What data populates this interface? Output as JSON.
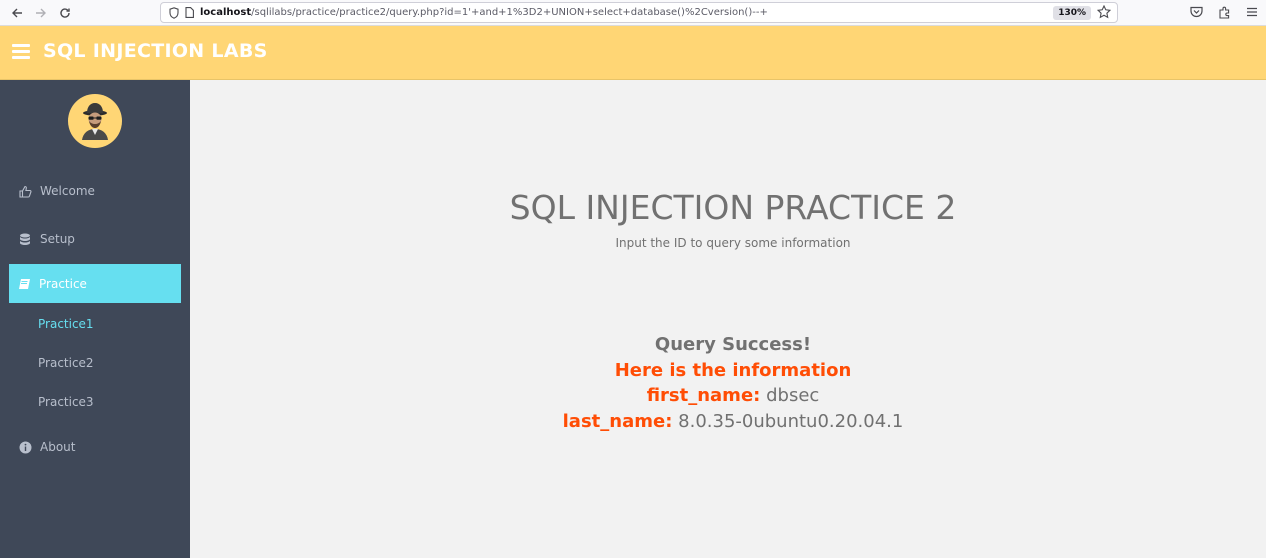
{
  "browser": {
    "url_host": "localhost",
    "url_path": "/sqlilabs/practice/practice2/query.php?id=1'+and+1%3D2+UNION+select+database()%2Cversion()--+",
    "zoom": "130%"
  },
  "header": {
    "title": "SQL INJECTION LABS",
    "bg_color": "#ffd675"
  },
  "sidebar": {
    "bg_color": "#3f4858",
    "accent_color": "#66dff0",
    "items": [
      {
        "label": "Welcome",
        "icon": "thumbs-up-icon"
      },
      {
        "label": "Setup",
        "icon": "database-icon"
      },
      {
        "label": "Practice",
        "icon": "book-icon",
        "active": true
      },
      {
        "label": "About",
        "icon": "info-icon"
      }
    ],
    "sub_items": [
      {
        "label": "Practice1",
        "current": true
      },
      {
        "label": "Practice2"
      },
      {
        "label": "Practice3"
      }
    ]
  },
  "main": {
    "title": "SQL INJECTION PRACTICE 2",
    "subtitle": "Input the ID to query some information",
    "result": {
      "status": "Query Success!",
      "info": "Here is the information",
      "first_name_label": "first_name:",
      "first_name_value": "dbsec",
      "last_name_label": "last_name:",
      "last_name_value": "8.0.35-0ubuntu0.20.04.1",
      "key_color": "#ff4d05"
    }
  }
}
